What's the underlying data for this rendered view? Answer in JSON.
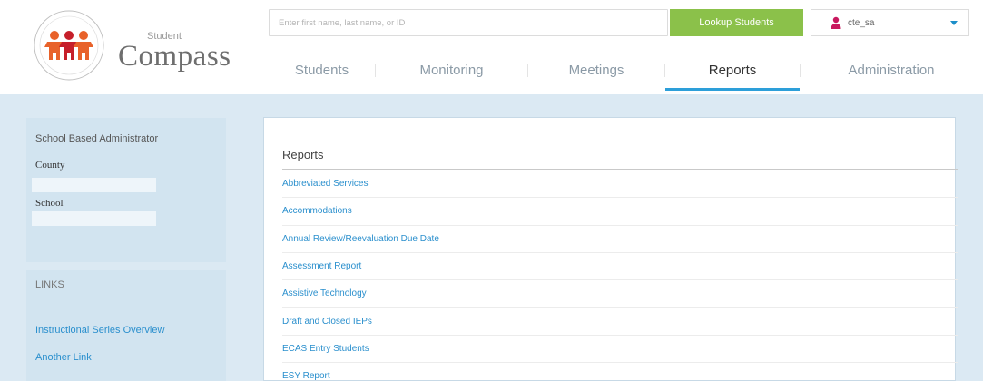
{
  "brand": {
    "name_small": "Student",
    "name_big": "Compass"
  },
  "search": {
    "placeholder": "Enter first name, last name, or ID",
    "button_label": "Lookup Students"
  },
  "user": {
    "username": "cte_sa",
    "icon": "user-icon",
    "icon_color": "#c8185e"
  },
  "nav": {
    "items": [
      {
        "label": "Students",
        "active": false
      },
      {
        "label": "Monitoring",
        "active": false
      },
      {
        "label": "Meetings",
        "active": false
      },
      {
        "label": "Reports",
        "active": true
      },
      {
        "label": "Administration",
        "active": false
      }
    ],
    "active_color": "#2d9fd9"
  },
  "sidebar": {
    "role": "School Based Administrator",
    "county_label": "County",
    "county_value": "",
    "school_label": "School",
    "school_value": "",
    "links_heading": "LINKS",
    "links": [
      {
        "label": "Instructional Series Overview"
      },
      {
        "label": "Another Link"
      }
    ]
  },
  "content": {
    "title": "Reports",
    "reports": [
      {
        "label": "Abbreviated Services"
      },
      {
        "label": "Accommodations"
      },
      {
        "label": "Annual Review/Reevaluation Due Date"
      },
      {
        "label": "Assessment Report"
      },
      {
        "label": "Assistive Technology"
      },
      {
        "label": "Draft and Closed IEPs"
      },
      {
        "label": "ECAS Entry Students"
      },
      {
        "label": "ESY Report"
      }
    ]
  },
  "colors": {
    "accent": "#2a8fcd",
    "lookup_button": "#8bc14a",
    "panel_bg": "#d2e4f0"
  }
}
